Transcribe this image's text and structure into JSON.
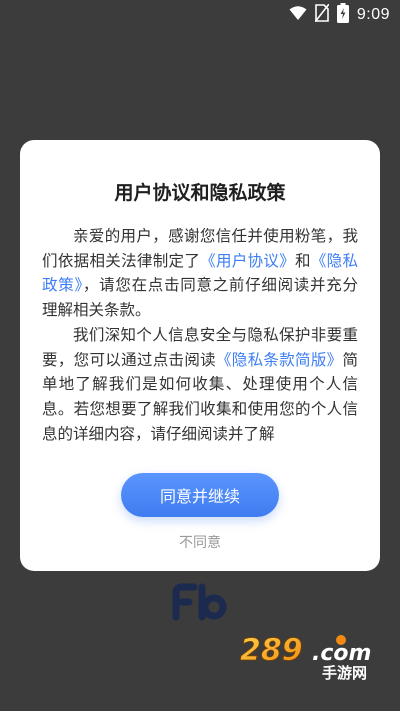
{
  "status_bar": {
    "time": "9:09",
    "icons": [
      "wifi-icon",
      "no-sim-icon",
      "battery-charging-icon"
    ],
    "text_color": "#ffffff"
  },
  "dialog": {
    "title": "用户协议和隐私政策",
    "para1": {
      "t1": "亲爱的用户，感谢您信任并使用粉笔，我们依据相关法律制定了",
      "link1": "《用户协议》",
      "t2": "和",
      "link2": "《隐私政策》",
      "t3": "，请您在点击同意之前仔细阅读并充分理解相关条款。"
    },
    "para2": {
      "t1": "我们深知个人信息安全与隐私保护非要重要，您可以通过点击阅读",
      "link1": "《隐私条款简版》",
      "t2": "简单地了解我们是如何收集、处理使用个人信息。若您想要了解我们收集和使用您的个人信息的详细内容，请仔细阅读并了解"
    },
    "agree_label": "同意并继续",
    "disagree_label": "不同意",
    "accent_color": "#3d7ef5"
  },
  "background": {
    "overlay_color": "#3c3c3c",
    "logo_icon": "fenbi-logo-icon"
  },
  "watermark": {
    "brand": "289.com",
    "subtitle": "手游网"
  }
}
